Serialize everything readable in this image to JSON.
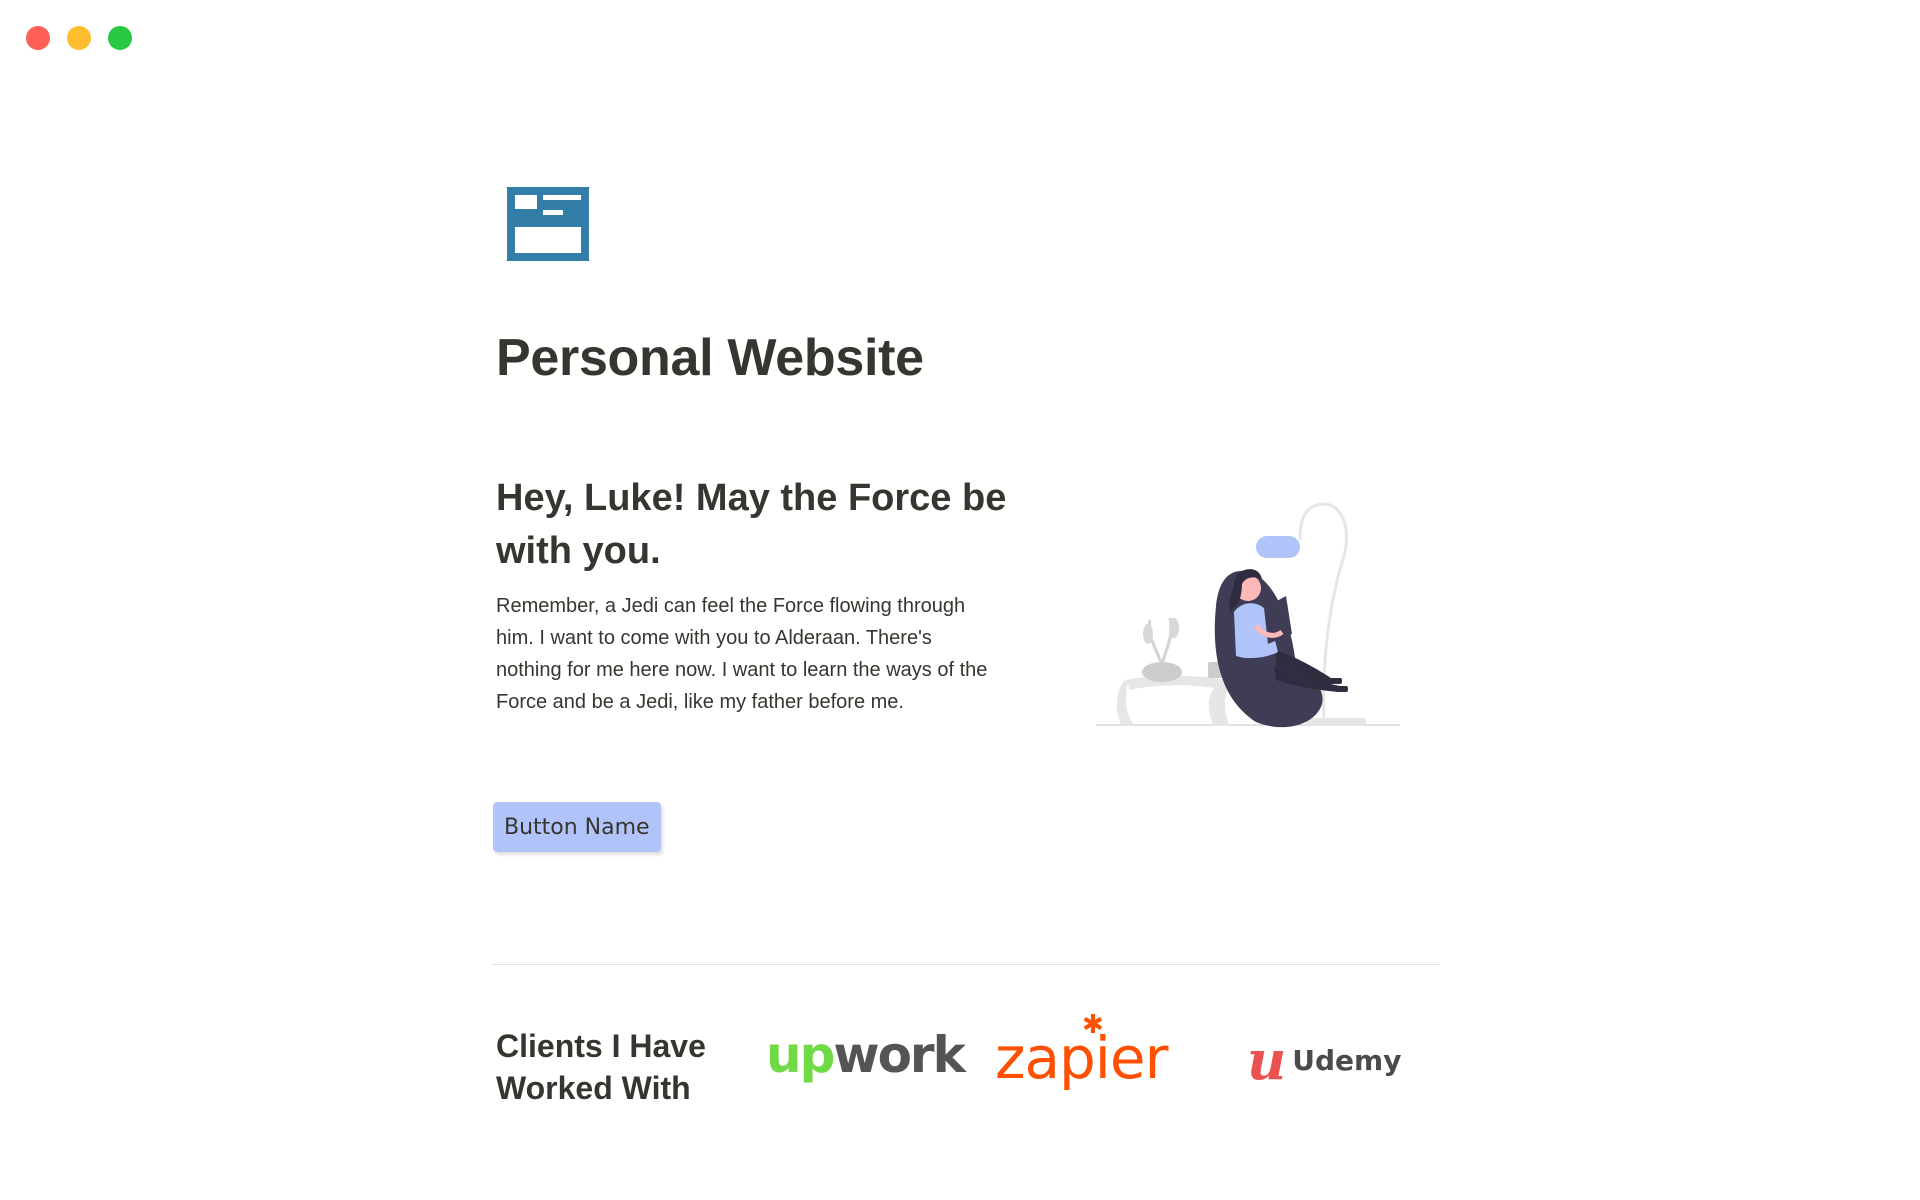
{
  "window": {
    "controls": [
      "close",
      "minimize",
      "zoom"
    ]
  },
  "page": {
    "icon": "newspaper-layout-icon",
    "title": "Personal Website"
  },
  "hero": {
    "heading": "Hey, Luke! May the Force be with you.",
    "body": "Remember, a Jedi can feel the Force flowing through him. I want to come with you to Alderaan. There's nothing for me here now. I want to learn the ways of the Force and be a Jedi, like my father before me.",
    "button_label": "Button Name",
    "illustration": "person-reading-in-beanbag-illustration"
  },
  "clients": {
    "heading": "Clients I Have Worked With",
    "logos": [
      {
        "name": "upwork",
        "text_up": "up",
        "text_rest": "work"
      },
      {
        "name": "zapier",
        "text": "zapier"
      },
      {
        "name": "udemy",
        "mark": "u",
        "text": "Udemy"
      }
    ]
  },
  "colors": {
    "accent_icon": "#337ea9",
    "button_bg": "#b0c4fa",
    "text": "#37352f",
    "upwork_green": "#6fda44",
    "zapier_orange": "#ff4f00",
    "udemy_red": "#ea5252"
  }
}
